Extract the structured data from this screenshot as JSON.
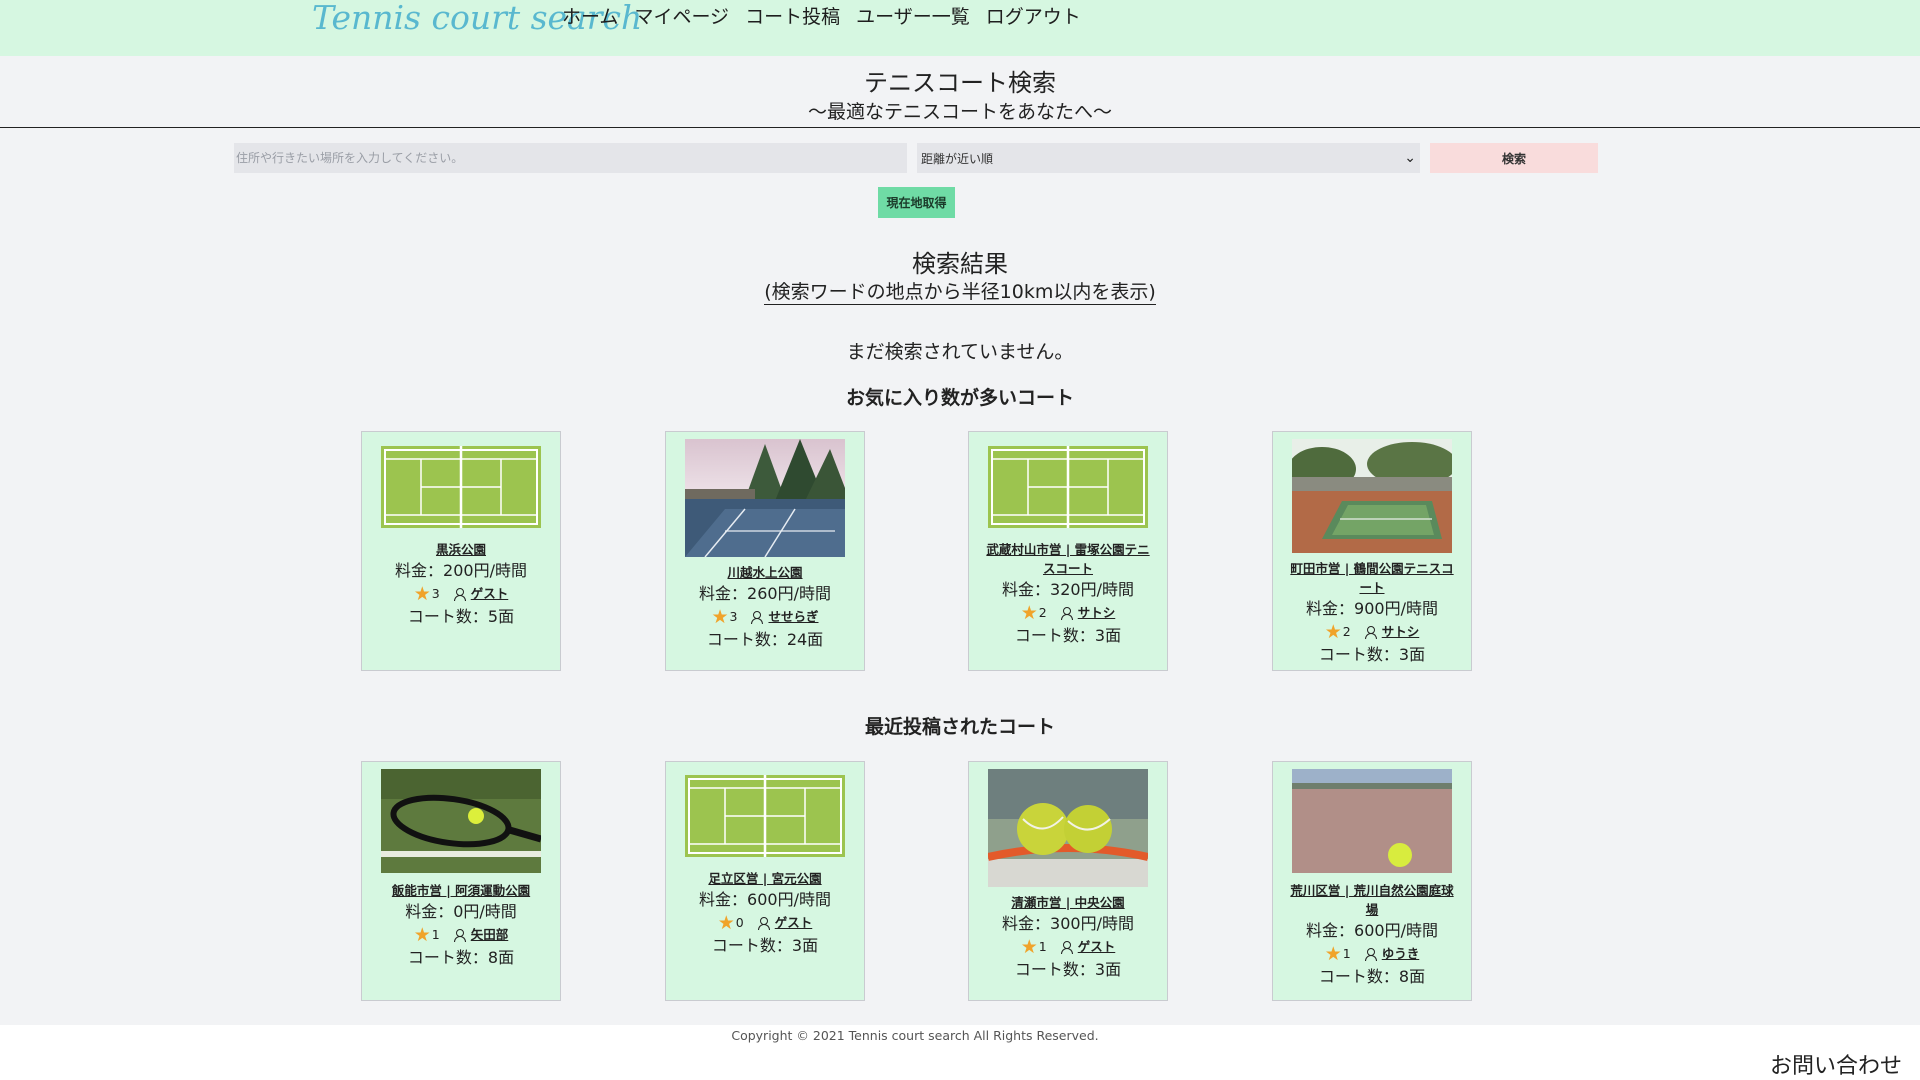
{
  "header": {
    "brand": "Tennis court search",
    "nav": [
      "ホーム",
      "マイページ",
      "コート投稿",
      "ユーザー一覧",
      "ログアウト"
    ]
  },
  "hero": {
    "title": "テニスコート検索",
    "subtitle": "〜最適なテニスコートをあなたへ〜"
  },
  "search": {
    "placeholder": "住所や行きたい場所を入力してください。",
    "sort_selected": "距離が近い順",
    "button": "検索",
    "location_button": "現在地取得"
  },
  "results": {
    "title": "検索結果",
    "note": "(検索ワードの地点から半径10km以内を表示)",
    "empty": "まだ検索されていません。"
  },
  "popular": {
    "title": "お気に入り数が多いコート",
    "items": [
      {
        "name": "黒浜公園",
        "price": "料金：200円/時間",
        "favorites": "3",
        "user": "ゲスト",
        "courts": "コート数：5面",
        "thumb": "court-diagram"
      },
      {
        "name": "川越水上公園",
        "price": "料金：260円/時間",
        "favorites": "3",
        "user": "せせらぎ",
        "courts": "コート数：24面",
        "thumb": "photo-park-court"
      },
      {
        "name": "武蔵村山市営 | 雷塚公園テニスコート",
        "price": "料金：320円/時間",
        "favorites": "2",
        "user": "サトシ",
        "courts": "コート数：3面",
        "thumb": "court-diagram"
      },
      {
        "name": "町田市営 | 鶴間公園テニスコート",
        "price": "料金：900円/時間",
        "favorites": "2",
        "user": "サトシ",
        "courts": "コート数：3面",
        "thumb": "photo-stadium-court"
      }
    ]
  },
  "recent": {
    "title": "最近投稿されたコート",
    "items": [
      {
        "name": "飯能市営 | 阿須運動公園",
        "price": "料金：0円/時間",
        "favorites": "1",
        "user": "矢田部",
        "courts": "コート数：8面",
        "thumb": "photo-racket-ball"
      },
      {
        "name": "足立区営 | 宮元公園",
        "price": "料金：600円/時間",
        "favorites": "0",
        "user": "ゲスト",
        "courts": "コート数：3面",
        "thumb": "court-diagram"
      },
      {
        "name": "清瀬市営 | 中央公園",
        "price": "料金：300円/時間",
        "favorites": "1",
        "user": "ゲスト",
        "courts": "コート数：3面",
        "thumb": "photo-balls-racket"
      },
      {
        "name": "荒川区営 | 荒川自然公園庭球場",
        "price": "料金：600円/時間",
        "favorites": "1",
        "user": "ゆうき",
        "courts": "コート数：8面",
        "thumb": "photo-ball-clay"
      }
    ]
  },
  "footer": {
    "copyright": "Copyright © 2021 Tennis court search All Rights Reserved.",
    "contact": "お問い合わせ"
  }
}
